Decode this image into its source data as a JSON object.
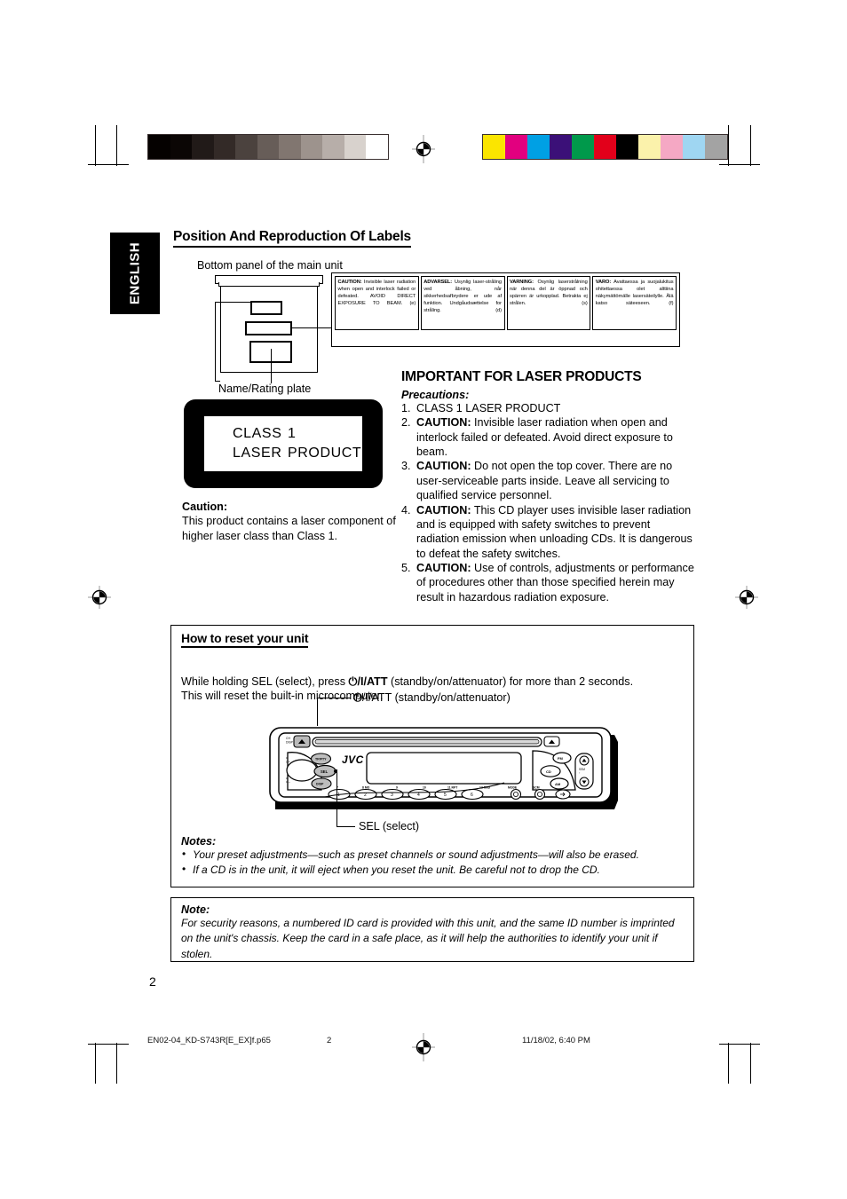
{
  "page": {
    "language_tab": "ENGLISH",
    "page_number": "2"
  },
  "section1": {
    "title": "Position And Reproduction Of Labels",
    "caption_bottom_panel": "Bottom panel of the main unit",
    "caption_name_rating": "Name/Rating plate",
    "labels": [
      {
        "lang_code": "(e)",
        "keyword": "CAUTION:",
        "body": " Invisible laser radiation when open and interlock failed or defeated. AVOID DIRECT EXPOSURE TO BEAM."
      },
      {
        "lang_code": "(d)",
        "keyword": "ADVARSEL:",
        "body": " Usynlig laser-stråling ved åbning, når sikkerhedsafbrydere er ude af funktion. Undgåudsættelse for stråling."
      },
      {
        "lang_code": "(s)",
        "keyword": "VARNING:",
        "body": " Osynlig laserstrålning när denna del är öppnad och spärren är urkopplad. Betrakta ej strålen."
      },
      {
        "lang_code": "(f)",
        "keyword": "VARO:",
        "body": " Avattaessa ja suojalukitus ohitettaessa olet alttiina näkymättömälle lasersäteilylle. Älä katso säteeseen."
      }
    ],
    "plate": {
      "line1_col1": "CLASS",
      "line1_col2": "1",
      "line2_col1": "LASER",
      "line2_col2": "PRODUCT"
    },
    "caution_heading": "Caution:",
    "caution_body": "This product contains a laser component of higher laser class than Class 1."
  },
  "section2": {
    "title": "IMPORTANT FOR LASER PRODUCTS",
    "precautions_heading": "Precautions:",
    "items": [
      {
        "num": "1.",
        "bold": "",
        "text": "CLASS 1 LASER PRODUCT"
      },
      {
        "num": "2.",
        "bold": "CAUTION:",
        "text": " Invisible laser radiation when open and interlock failed or defeated. Avoid direct exposure to beam."
      },
      {
        "num": "3.",
        "bold": "CAUTION:",
        "text": " Do not open the top cover. There are no user-serviceable parts inside. Leave all servicing to qualified service personnel."
      },
      {
        "num": "4.",
        "bold": "CAUTION:",
        "text": " This CD player uses invisible laser radiation and is equipped with safety switches to prevent radiation emission when unloading CDs. It is dangerous to defeat the safety switches."
      },
      {
        "num": "5.",
        "bold": "CAUTION:",
        "text": " Use of controls, adjustments or performance of procedures other than those specified herein may result in hazardous radiation exposure."
      }
    ]
  },
  "section3": {
    "title": "How to reset your unit",
    "instruction_part1": "While holding SEL (select), press ",
    "instruction_symbol": "/I/ATT",
    "instruction_part2": "  (standby/on/attenuator) for more than 2 seconds.",
    "instruction_line2": "This will reset the built-in microcomputer.",
    "callout_power": "/I/ATT  (standby/on/attenuator)",
    "callout_sel": "SEL (select)",
    "notes_heading": "Notes:",
    "notes": [
      "Your preset adjustments—such as preset channels or sound adjustments—will also be erased.",
      "If a CD is in the unit, it will eject when you reset the unit. Be careful not to drop the CD."
    ]
  },
  "section4": {
    "note_heading": "Note:",
    "note_body": "For security reasons, a numbered ID card is provided with this unit, and the same ID number is imprinted on the unit's chassis. Keep the card in a safe place, as it will help the authorities to identify your unit if stolen."
  },
  "stereo": {
    "brand": "JVC",
    "preset_numbers": [
      "1",
      "2",
      "3",
      "4",
      "5",
      "6"
    ],
    "preset_upper_labels": [
      "7",
      "8  MO",
      "9",
      "10",
      "11  RPT",
      "12  RND"
    ],
    "right_buttons": [
      "FM",
      "CD",
      "AM"
    ],
    "bottom_labels": [
      "MODE",
      "SCM"
    ],
    "ssm_label": "SSM"
  },
  "footer": {
    "filename": "EN02-04_KD-S743R[E_EX]f.p65",
    "page": "2",
    "timestamp": "11/18/02, 6:40 PM"
  },
  "calibration": {
    "gray_scale": [
      "#050100",
      "#0b0605",
      "#211a18",
      "#332a27",
      "#4b423e",
      "#675d58",
      "#817670",
      "#9d938d",
      "#b7aea9",
      "#d8d2cd",
      "#ffffff"
    ],
    "color_scale": [
      "#fbe500",
      "#e2007f",
      "#00a0e4",
      "#3b1078",
      "#00994b",
      "#e2001a",
      "#000000",
      "#fbf2ab",
      "#f5a8c4",
      "#9fd6f2",
      "#a3a3a3"
    ]
  }
}
